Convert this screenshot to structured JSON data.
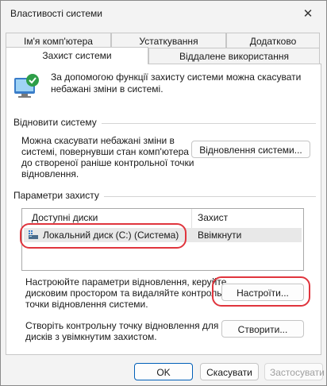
{
  "window": {
    "title": "Властивості системи",
    "close_glyph": "✕"
  },
  "tabs": {
    "row1": [
      "Ім'я комп'ютера",
      "Устаткування",
      "Додатково"
    ],
    "row2": [
      "Захист системи",
      "Віддалене використання"
    ],
    "active": "Захист системи"
  },
  "intro": {
    "text_line1": "За допомогою функції захисту системи можна скасувати",
    "text_line2": "небажані зміни в системі.",
    "icon": "system-protection-icon"
  },
  "restore_section": {
    "heading": "Відновити систему",
    "description_lines": [
      "Можна скасувати небажані зміни в",
      "системі, повернувши стан комп'ютера",
      "до створеної раніше контрольної точки",
      "відновлення."
    ],
    "button_label": "Відновлення системи..."
  },
  "protection_section": {
    "heading": "Параметри захисту",
    "table": {
      "columns": [
        "Доступні диски",
        "Захист"
      ],
      "rows": [
        {
          "drive": "Локальний диск (C:) (Система)",
          "protection": "Ввімкнути",
          "icon": "drive-icon"
        }
      ]
    },
    "configure_lines": [
      "Настроюйте параметри відновлення, керуйте",
      "дисковим простором та видаляйте контрольні",
      "точки відновлення системи."
    ],
    "configure_button": "Настроїти...",
    "create_lines": [
      "Створіть контрольну точку відновлення для",
      "дисків з увімкнутим захистом."
    ],
    "create_button": "Створити..."
  },
  "footer": {
    "ok": "OK",
    "cancel": "Скасувати",
    "apply": "Застосувати"
  },
  "colors": {
    "highlight_circle": "#e0353d",
    "primary_border": "#005fb8"
  }
}
